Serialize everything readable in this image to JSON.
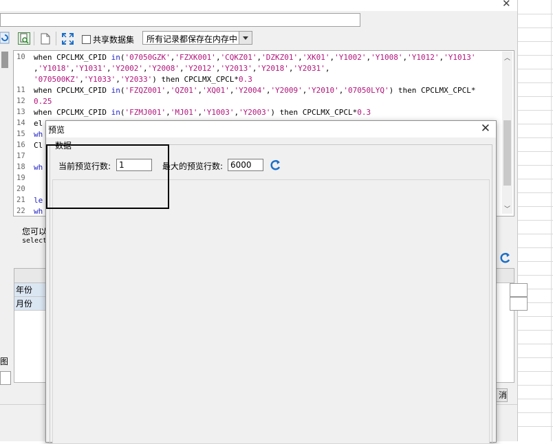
{
  "back": {
    "close_label": "✕",
    "toolbar": {
      "share_label": "共享数据集",
      "store_select": "所有记录都保存在内存中"
    },
    "code_lines": [
      {
        "num": "10",
        "parts": [
          [
            "t",
            "when CPCLMX_CPID "
          ],
          [
            "k",
            "in"
          ],
          [
            "t",
            "("
          ],
          [
            "s",
            "'07050GZK'"
          ],
          [
            "t",
            ","
          ],
          [
            "s",
            "'FZXK001'"
          ],
          [
            "t",
            ","
          ],
          [
            "s",
            "'CQKZ01'"
          ],
          [
            "t",
            ","
          ],
          [
            "s",
            "'DZKZ01'"
          ],
          [
            "t",
            ","
          ],
          [
            "s",
            "'XK01'"
          ],
          [
            "t",
            ","
          ],
          [
            "s",
            "'Y1002'"
          ],
          [
            "t",
            ","
          ],
          [
            "s",
            "'Y1008'"
          ],
          [
            "t",
            ","
          ],
          [
            "s",
            "'Y1012'"
          ],
          [
            "t",
            ","
          ],
          [
            "s",
            "'Y1013'"
          ]
        ]
      },
      {
        "num": "",
        "parts": [
          [
            "t",
            ","
          ],
          [
            "s",
            "'Y1018'"
          ],
          [
            "t",
            ","
          ],
          [
            "s",
            "'Y1031'"
          ],
          [
            "t",
            ","
          ],
          [
            "s",
            "'Y2002'"
          ],
          [
            "t",
            ","
          ],
          [
            "s",
            "'Y2008'"
          ],
          [
            "t",
            ","
          ],
          [
            "s",
            "'Y2012'"
          ],
          [
            "t",
            ","
          ],
          [
            "s",
            "'Y2013'"
          ],
          [
            "t",
            ","
          ],
          [
            "s",
            "'Y2018'"
          ],
          [
            "t",
            ","
          ],
          [
            "s",
            "'Y2031'"
          ],
          [
            "t",
            ","
          ]
        ]
      },
      {
        "num": "",
        "parts": [
          [
            "s",
            "'070500KZ'"
          ],
          [
            "t",
            ","
          ],
          [
            "s",
            "'Y1033'"
          ],
          [
            "t",
            ","
          ],
          [
            "s",
            "'Y2033'"
          ],
          [
            "t",
            ") then CPCLMX_CPCL*"
          ],
          [
            "s",
            "0.3"
          ]
        ]
      },
      {
        "num": "11",
        "parts": [
          [
            "t",
            "when CPCLMX_CPID "
          ],
          [
            "k",
            "in"
          ],
          [
            "t",
            "("
          ],
          [
            "s",
            "'FZQZ001'"
          ],
          [
            "t",
            ","
          ],
          [
            "s",
            "'QZ01'"
          ],
          [
            "t",
            ","
          ],
          [
            "s",
            "'XQ01'"
          ],
          [
            "t",
            ","
          ],
          [
            "s",
            "'Y2004'"
          ],
          [
            "t",
            ","
          ],
          [
            "s",
            "'Y2009'"
          ],
          [
            "t",
            ","
          ],
          [
            "s",
            "'Y2010'"
          ],
          [
            "t",
            ","
          ],
          [
            "s",
            "'07050LYQ'"
          ],
          [
            "t",
            ") then CPCLMX_CPCL*"
          ]
        ]
      },
      {
        "num": "12",
        "parts": [
          [
            "s",
            "0.25"
          ]
        ]
      },
      {
        "num": "13",
        "parts": [
          [
            "t",
            "when CPCLMX_CPID "
          ],
          [
            "k",
            "in"
          ],
          [
            "t",
            "("
          ],
          [
            "s",
            "'FZMJ001'"
          ],
          [
            "t",
            ","
          ],
          [
            "s",
            "'MJ01'"
          ],
          [
            "t",
            ","
          ],
          [
            "s",
            "'Y1003'"
          ],
          [
            "t",
            ","
          ],
          [
            "s",
            "'Y2003'"
          ],
          [
            "t",
            ") then CPCLMX_CPCL*"
          ],
          [
            "s",
            "0.3"
          ]
        ]
      },
      {
        "num": "14",
        "parts": [
          [
            "t",
            "el"
          ]
        ]
      },
      {
        "num": "15",
        "parts": [
          [
            "k",
            "wh"
          ]
        ]
      },
      {
        "num": "16",
        "parts": [
          [
            "t",
            "Cl"
          ]
        ]
      },
      {
        "num": "17",
        "parts": [
          [
            "t",
            ""
          ]
        ]
      },
      {
        "num": "18",
        "parts": [
          [
            "k",
            "wh"
          ]
        ]
      },
      {
        "num": "19",
        "parts": [
          [
            "t",
            ""
          ]
        ]
      },
      {
        "num": "20",
        "parts": [
          [
            "t",
            ""
          ]
        ]
      },
      {
        "num": "21",
        "parts": [
          [
            "k",
            "le"
          ]
        ]
      },
      {
        "num": "22",
        "parts": [
          [
            "k",
            "wh"
          ]
        ]
      }
    ],
    "hint_text": "您可以",
    "hint_sub": "select",
    "rows": [
      "年份",
      "月份"
    ],
    "left_label": "图",
    "cancel_label": "消"
  },
  "preview": {
    "title": "预览",
    "group_label": "数据",
    "current_rows_label": "当前预览行数:",
    "current_rows_value": "1",
    "max_rows_label": "最大的预览行数:",
    "max_rows_value": "6000",
    "close_label": "✕"
  }
}
